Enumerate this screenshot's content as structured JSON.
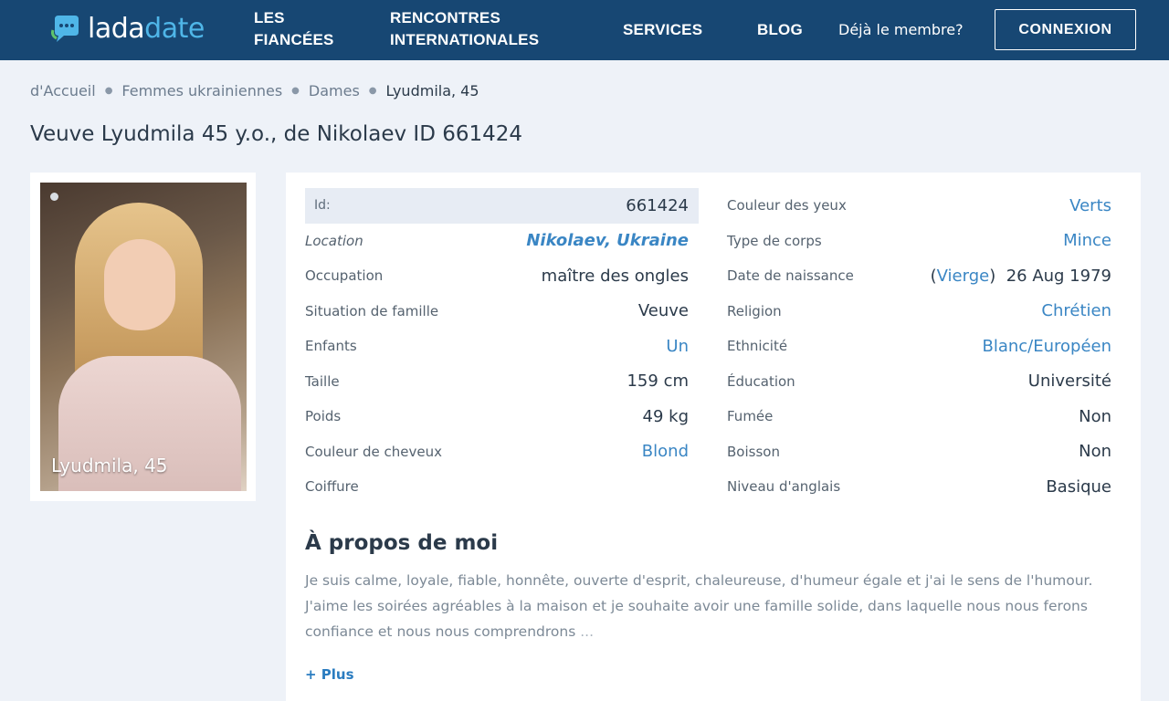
{
  "header": {
    "logo_part1": "lada",
    "logo_part2": "date",
    "nav": {
      "fiancees_line1": "LES",
      "fiancees_line2": "FIANCÉES",
      "rencontres_line1": "RENCONTRES",
      "rencontres_line2": "INTERNATIONALES",
      "services": "SERVICES",
      "blog": "BLOG"
    },
    "member_text": "Déjà le membre?",
    "connexion_label": "CONNEXION"
  },
  "breadcrumb": [
    "d'Accueil",
    "Femmes ukrainiennes",
    "Dames",
    "Lyudmila, 45"
  ],
  "page_title": "Veuve Lyudmila 45 y.o., de Nikolaev ID 661424",
  "photo": {
    "caption": "Lyudmila, 45"
  },
  "profile": {
    "left": [
      {
        "label": "Id:",
        "value": "661424"
      },
      {
        "label": "Location",
        "value": "Nikolaev, Ukraine"
      },
      {
        "label": "Occupation",
        "value": "maître des ongles"
      },
      {
        "label": "Situation de famille",
        "value": "Veuve"
      },
      {
        "label": "Enfants",
        "value": "Un"
      },
      {
        "label": "Taille",
        "value": "159 cm"
      },
      {
        "label": "Poids",
        "value": "49 kg"
      },
      {
        "label": "Couleur de cheveux",
        "value": "Blond"
      },
      {
        "label": "Coiffure",
        "value": ""
      }
    ],
    "right": [
      {
        "label": "Couleur des yeux",
        "value": "Verts"
      },
      {
        "label": "Type de corps",
        "value": "Mince"
      },
      {
        "label": "Date de naissance",
        "zodiac": "Vierge",
        "value": "26 Aug 1979"
      },
      {
        "label": "Religion",
        "value": "Chrétien"
      },
      {
        "label": "Ethnicité",
        "value": "Blanc/Européen"
      },
      {
        "label": "Éducation",
        "value": "Université"
      },
      {
        "label": "Fumée",
        "value": "Non"
      },
      {
        "label": "Boisson",
        "value": "Non"
      },
      {
        "label": "Niveau d'anglais",
        "value": "Basique"
      }
    ]
  },
  "about": {
    "title": "À propos de moi",
    "text": "Je suis calme, loyale, fiable, honnête, ouverte d'esprit, chaleureuse, d'humeur égale et j'ai le sens de l'humour. J'aime les soirées agréables à la maison et je souhaite avoir une famille solide, dans laquelle nous nous ferons confiance et nous nous comprendrons",
    "ellipsis": "...",
    "more_label": "+ Plus"
  },
  "colors": {
    "header_bg": "#174773",
    "accent_link": "#3a86c4",
    "logo_accent": "#4fb6e8",
    "page_bg": "#eef2f8"
  }
}
